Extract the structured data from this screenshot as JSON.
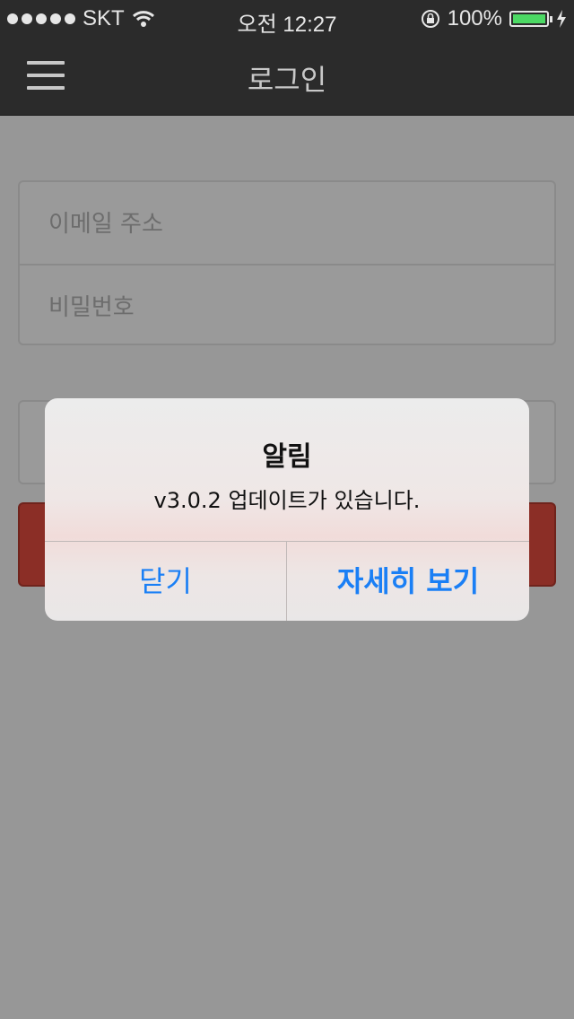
{
  "status_bar": {
    "carrier": "SKT",
    "time": "오전 12:27",
    "battery_percent": "100%",
    "signal_dots": 5,
    "icons": [
      "wifi-icon",
      "rotation-lock-icon",
      "battery-icon",
      "charging-icon"
    ]
  },
  "nav": {
    "title": "로그인",
    "menu_icon": "hamburger-menu-icon"
  },
  "login_form": {
    "email_placeholder": "이메일 주소",
    "email_value": "",
    "password_placeholder": "비밀번호",
    "password_value": ""
  },
  "alert": {
    "title": "알림",
    "message": "v3.0.2 업데이트가 있습니다.",
    "close_label": "닫기",
    "details_label": "자세히 보기"
  },
  "colors": {
    "navbar": "#2b2b2b",
    "overlay_background": "#979797",
    "login_button": "#8b2e26",
    "alert_button_text": "#1a7ff5",
    "battery_fill": "#4cd964"
  }
}
